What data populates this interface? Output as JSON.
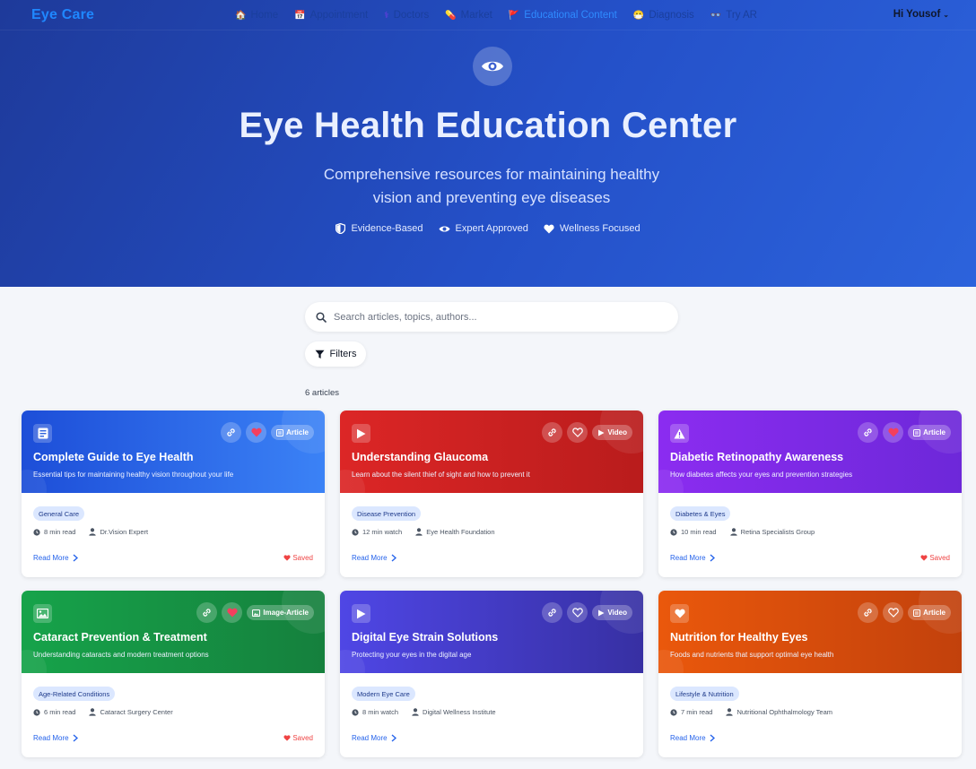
{
  "nav": {
    "brand": "Eye Care",
    "links": [
      {
        "label": "Home",
        "icon": "house-icon"
      },
      {
        "label": "Appointment",
        "icon": "calendar-icon"
      },
      {
        "label": "Doctors",
        "icon": "stethoscope-icon"
      },
      {
        "label": "Market",
        "icon": "pill-icon"
      },
      {
        "label": "Educational Content",
        "icon": "flag-icon",
        "active": true
      },
      {
        "label": "Diagnosis",
        "icon": "mask-icon"
      },
      {
        "label": "Try AR",
        "icon": "glasses-icon"
      }
    ],
    "user": "Hi Yousof"
  },
  "hero": {
    "title": "Eye Health Education Center",
    "subtitle": "Comprehensive resources for maintaining healthy vision and preventing eye diseases",
    "badges": [
      {
        "label": "Evidence-Based",
        "icon": "shield-icon"
      },
      {
        "label": "Expert Approved",
        "icon": "eye-icon"
      },
      {
        "label": "Wellness Focused",
        "icon": "heart-icon"
      }
    ]
  },
  "search": {
    "placeholder": "Search articles, topics, authors..."
  },
  "filters_label": "Filters",
  "count_label": "6 articles",
  "cards": [
    {
      "title": "Complete Guide to Eye Health",
      "description": "Essential tips for maintaining healthy vision throughout your life",
      "type": "Article",
      "tag": "General Care",
      "time": "8 min read",
      "author": "Dr.Vision Expert",
      "read_more": "Read More",
      "saved": "Saved",
      "favorited": true,
      "color": "#2563eb"
    },
    {
      "title": "Understanding Glaucoma",
      "description": "Learn about the silent thief of sight and how to prevent it",
      "type": "Video",
      "tag": "Disease Prevention",
      "time": "12 min watch",
      "author": "Eye Health Foundation",
      "read_more": "Read More",
      "saved": "",
      "favorited": false,
      "color": "#dc2626"
    },
    {
      "title": "Diabetic Retinopathy Awareness",
      "description": "How diabetes affects your eyes and prevention strategies",
      "type": "Article",
      "tag": "Diabetes & Eyes",
      "time": "10 min read",
      "author": "Retina Specialists Group",
      "read_more": "Read More",
      "saved": "Saved",
      "favorited": true,
      "color": "#7c3aed"
    },
    {
      "title": "Cataract Prevention & Treatment",
      "description": "Understanding cataracts and modern treatment options",
      "type": "Image-Article",
      "tag": "Age-Related Conditions",
      "time": "6 min read",
      "author": "Cataract Surgery Center",
      "read_more": "Read More",
      "saved": "Saved",
      "favorited": true,
      "color": "#16a34a"
    },
    {
      "title": "Digital Eye Strain Solutions",
      "description": "Protecting your eyes in the digital age",
      "type": "Video",
      "tag": "Modern Eye Care",
      "time": "8 min watch",
      "author": "Digital Wellness Institute",
      "read_more": "Read More",
      "saved": "",
      "favorited": false,
      "color": "#4f46e5"
    },
    {
      "title": "Nutrition for Healthy Eyes",
      "description": "Foods and nutrients that support optimal eye health",
      "type": "Article",
      "tag": "Lifestyle & Nutrition",
      "time": "7 min read",
      "author": "Nutritional Ophthalmology Team",
      "read_more": "Read More",
      "saved": "",
      "favorited": false,
      "color": "#ea580c"
    }
  ]
}
